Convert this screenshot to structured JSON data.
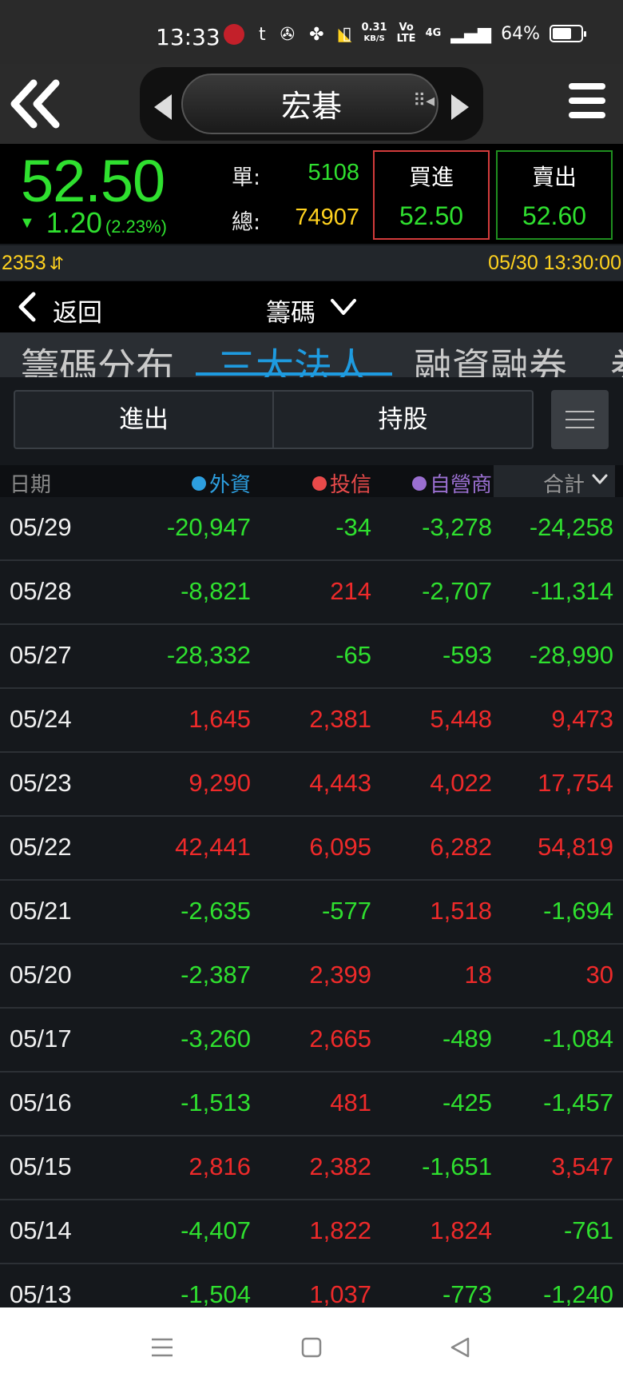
{
  "status_bar": {
    "time": "13:33",
    "net_speed_value": "0.31",
    "net_speed_unit": "KB/S",
    "volte_label": "Vo LTE",
    "network_label": "4G",
    "battery": "64%",
    "battery_level": 0.64
  },
  "header": {
    "stock_name": "宏碁"
  },
  "quote": {
    "price": "52.50",
    "change": "1.20",
    "change_pct": "(2.23%)",
    "single_label": "單:",
    "single_value": "5108",
    "total_label": "總:",
    "total_value": "74907",
    "buy_label": "買進",
    "buy_price": "52.50",
    "sell_label": "賣出",
    "sell_price": "52.60"
  },
  "ticker": {
    "code": "2353",
    "datetime": "05/30 13:30:00"
  },
  "subnav": {
    "back_label": "返回",
    "section_label": "籌碼"
  },
  "big_tabs": [
    "籌碼分布",
    "三大法人",
    "融資融券",
    "券"
  ],
  "active_big_tab": "三大法人",
  "segments": {
    "in_out": "進出",
    "holdings": "持股"
  },
  "columns": {
    "date": "日期",
    "foreign": "外資",
    "trust": "投信",
    "dealer": "自營商",
    "total": "合計"
  },
  "colors": {
    "negative": "#2fe02f",
    "positive": "#ee2a2a",
    "accent": "#1e9be0",
    "foreign_dot": "#2d9fe0",
    "trust_dot": "#e84a4a",
    "dealer_dot": "#9a6fd0"
  },
  "rows": [
    {
      "date": "05/29",
      "foreign": "-20,947",
      "trust": "-34",
      "dealer": "-3,278",
      "total": "-24,258"
    },
    {
      "date": "05/28",
      "foreign": "-8,821",
      "trust": "214",
      "dealer": "-2,707",
      "total": "-11,314"
    },
    {
      "date": "05/27",
      "foreign": "-28,332",
      "trust": "-65",
      "dealer": "-593",
      "total": "-28,990"
    },
    {
      "date": "05/24",
      "foreign": "1,645",
      "trust": "2,381",
      "dealer": "5,448",
      "total": "9,473"
    },
    {
      "date": "05/23",
      "foreign": "9,290",
      "trust": "4,443",
      "dealer": "4,022",
      "total": "17,754"
    },
    {
      "date": "05/22",
      "foreign": "42,441",
      "trust": "6,095",
      "dealer": "6,282",
      "total": "54,819"
    },
    {
      "date": "05/21",
      "foreign": "-2,635",
      "trust": "-577",
      "dealer": "1,518",
      "total": "-1,694"
    },
    {
      "date": "05/20",
      "foreign": "-2,387",
      "trust": "2,399",
      "dealer": "18",
      "total": "30"
    },
    {
      "date": "05/17",
      "foreign": "-3,260",
      "trust": "2,665",
      "dealer": "-489",
      "total": "-1,084"
    },
    {
      "date": "05/16",
      "foreign": "-1,513",
      "trust": "481",
      "dealer": "-425",
      "total": "-1,457"
    },
    {
      "date": "05/15",
      "foreign": "2,816",
      "trust": "2,382",
      "dealer": "-1,651",
      "total": "3,547"
    },
    {
      "date": "05/14",
      "foreign": "-4,407",
      "trust": "1,822",
      "dealer": "1,824",
      "total": "-761"
    },
    {
      "date": "05/13",
      "foreign": "-1,504",
      "trust": "1,037",
      "dealer": "-773",
      "total": "-1,240"
    }
  ],
  "icons": {
    "back_double": "double-chevron-left-icon",
    "prev_stock": "triangle-left-icon",
    "next_stock": "triangle-right-icon",
    "menu": "hamburger-menu-icon",
    "list_settings": "list-icon",
    "nav_recents": "recents-icon",
    "nav_home": "home-icon",
    "nav_back": "back-triangle-icon"
  }
}
